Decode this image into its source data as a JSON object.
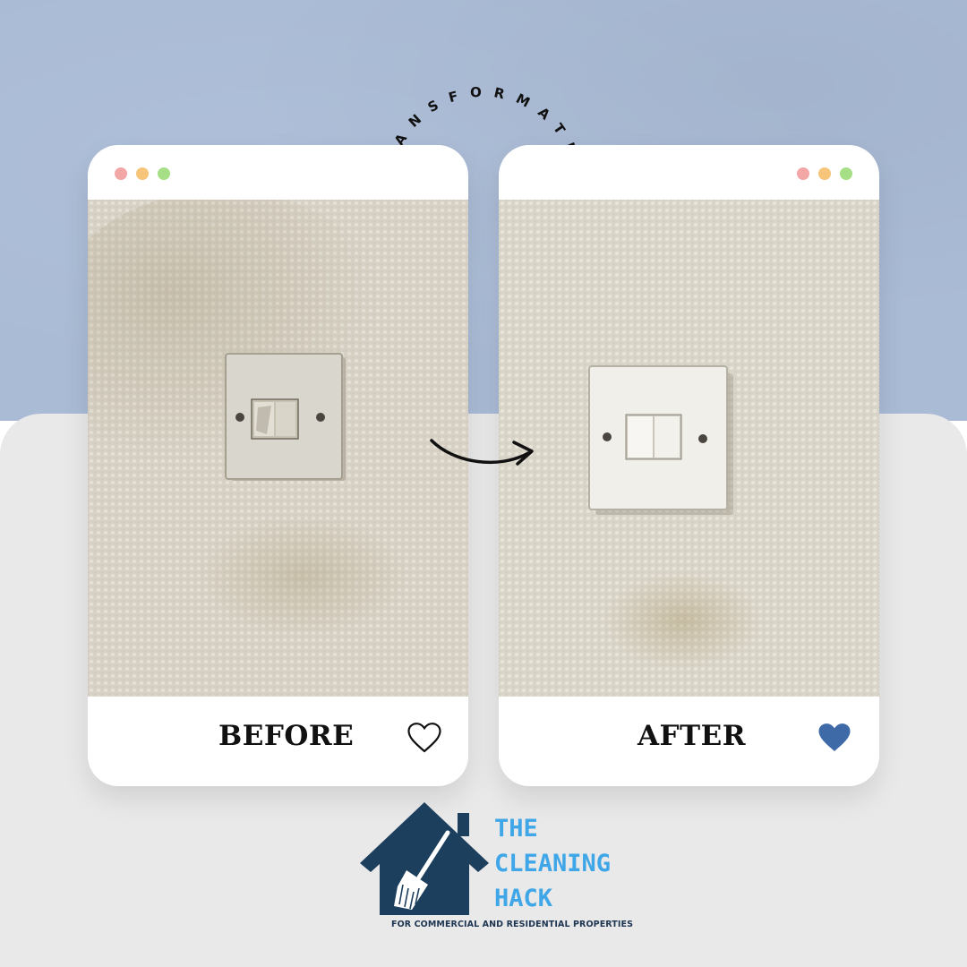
{
  "header": {
    "arc_title": "TRANSFORMATION"
  },
  "cards": {
    "before": {
      "label": "BEFORE",
      "heart": "heart-outline-icon"
    },
    "after": {
      "label": "AFTER",
      "heart": "heart-filled-icon"
    }
  },
  "logo": {
    "line1": "THE",
    "line2": "CLEANING",
    "line3": "HACK",
    "tagline": "FOR COMMERCIAL AND RESIDENTIAL PROPERTIES"
  },
  "colors": {
    "background_top": "#aabbd6",
    "background_bottom": "#e9e9ea",
    "card": "#ffffff",
    "heart_filled": "#3f6aa8",
    "logo_house": "#1d3f5e",
    "logo_text": "#3fa6e8"
  }
}
